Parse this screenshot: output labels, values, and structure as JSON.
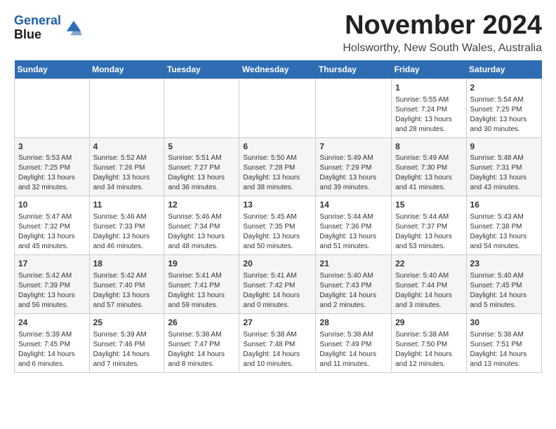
{
  "header": {
    "logo_line1": "General",
    "logo_line2": "Blue",
    "month_year": "November 2024",
    "location": "Holsworthy, New South Wales, Australia"
  },
  "days_of_week": [
    "Sunday",
    "Monday",
    "Tuesday",
    "Wednesday",
    "Thursday",
    "Friday",
    "Saturday"
  ],
  "weeks": [
    [
      {
        "day": "",
        "content": ""
      },
      {
        "day": "",
        "content": ""
      },
      {
        "day": "",
        "content": ""
      },
      {
        "day": "",
        "content": ""
      },
      {
        "day": "",
        "content": ""
      },
      {
        "day": "1",
        "content": "Sunrise: 5:55 AM\nSunset: 7:24 PM\nDaylight: 13 hours\nand 28 minutes."
      },
      {
        "day": "2",
        "content": "Sunrise: 5:54 AM\nSunset: 7:25 PM\nDaylight: 13 hours\nand 30 minutes."
      }
    ],
    [
      {
        "day": "3",
        "content": "Sunrise: 5:53 AM\nSunset: 7:25 PM\nDaylight: 13 hours\nand 32 minutes."
      },
      {
        "day": "4",
        "content": "Sunrise: 5:52 AM\nSunset: 7:26 PM\nDaylight: 13 hours\nand 34 minutes."
      },
      {
        "day": "5",
        "content": "Sunrise: 5:51 AM\nSunset: 7:27 PM\nDaylight: 13 hours\nand 36 minutes."
      },
      {
        "day": "6",
        "content": "Sunrise: 5:50 AM\nSunset: 7:28 PM\nDaylight: 13 hours\nand 38 minutes."
      },
      {
        "day": "7",
        "content": "Sunrise: 5:49 AM\nSunset: 7:29 PM\nDaylight: 13 hours\nand 39 minutes."
      },
      {
        "day": "8",
        "content": "Sunrise: 5:49 AM\nSunset: 7:30 PM\nDaylight: 13 hours\nand 41 minutes."
      },
      {
        "day": "9",
        "content": "Sunrise: 5:48 AM\nSunset: 7:31 PM\nDaylight: 13 hours\nand 43 minutes."
      }
    ],
    [
      {
        "day": "10",
        "content": "Sunrise: 5:47 AM\nSunset: 7:32 PM\nDaylight: 13 hours\nand 45 minutes."
      },
      {
        "day": "11",
        "content": "Sunrise: 5:46 AM\nSunset: 7:33 PM\nDaylight: 13 hours\nand 46 minutes."
      },
      {
        "day": "12",
        "content": "Sunrise: 5:46 AM\nSunset: 7:34 PM\nDaylight: 13 hours\nand 48 minutes."
      },
      {
        "day": "13",
        "content": "Sunrise: 5:45 AM\nSunset: 7:35 PM\nDaylight: 13 hours\nand 50 minutes."
      },
      {
        "day": "14",
        "content": "Sunrise: 5:44 AM\nSunset: 7:36 PM\nDaylight: 13 hours\nand 51 minutes."
      },
      {
        "day": "15",
        "content": "Sunrise: 5:44 AM\nSunset: 7:37 PM\nDaylight: 13 hours\nand 53 minutes."
      },
      {
        "day": "16",
        "content": "Sunrise: 5:43 AM\nSunset: 7:38 PM\nDaylight: 13 hours\nand 54 minutes."
      }
    ],
    [
      {
        "day": "17",
        "content": "Sunrise: 5:42 AM\nSunset: 7:39 PM\nDaylight: 13 hours\nand 56 minutes."
      },
      {
        "day": "18",
        "content": "Sunrise: 5:42 AM\nSunset: 7:40 PM\nDaylight: 13 hours\nand 57 minutes."
      },
      {
        "day": "19",
        "content": "Sunrise: 5:41 AM\nSunset: 7:41 PM\nDaylight: 13 hours\nand 59 minutes."
      },
      {
        "day": "20",
        "content": "Sunrise: 5:41 AM\nSunset: 7:42 PM\nDaylight: 14 hours\nand 0 minutes."
      },
      {
        "day": "21",
        "content": "Sunrise: 5:40 AM\nSunset: 7:43 PM\nDaylight: 14 hours\nand 2 minutes."
      },
      {
        "day": "22",
        "content": "Sunrise: 5:40 AM\nSunset: 7:44 PM\nDaylight: 14 hours\nand 3 minutes."
      },
      {
        "day": "23",
        "content": "Sunrise: 5:40 AM\nSunset: 7:45 PM\nDaylight: 14 hours\nand 5 minutes."
      }
    ],
    [
      {
        "day": "24",
        "content": "Sunrise: 5:39 AM\nSunset: 7:45 PM\nDaylight: 14 hours\nand 6 minutes."
      },
      {
        "day": "25",
        "content": "Sunrise: 5:39 AM\nSunset: 7:46 PM\nDaylight: 14 hours\nand 7 minutes."
      },
      {
        "day": "26",
        "content": "Sunrise: 5:38 AM\nSunset: 7:47 PM\nDaylight: 14 hours\nand 8 minutes."
      },
      {
        "day": "27",
        "content": "Sunrise: 5:38 AM\nSunset: 7:48 PM\nDaylight: 14 hours\nand 10 minutes."
      },
      {
        "day": "28",
        "content": "Sunrise: 5:38 AM\nSunset: 7:49 PM\nDaylight: 14 hours\nand 11 minutes."
      },
      {
        "day": "29",
        "content": "Sunrise: 5:38 AM\nSunset: 7:50 PM\nDaylight: 14 hours\nand 12 minutes."
      },
      {
        "day": "30",
        "content": "Sunrise: 5:38 AM\nSunset: 7:51 PM\nDaylight: 14 hours\nand 13 minutes."
      }
    ]
  ]
}
